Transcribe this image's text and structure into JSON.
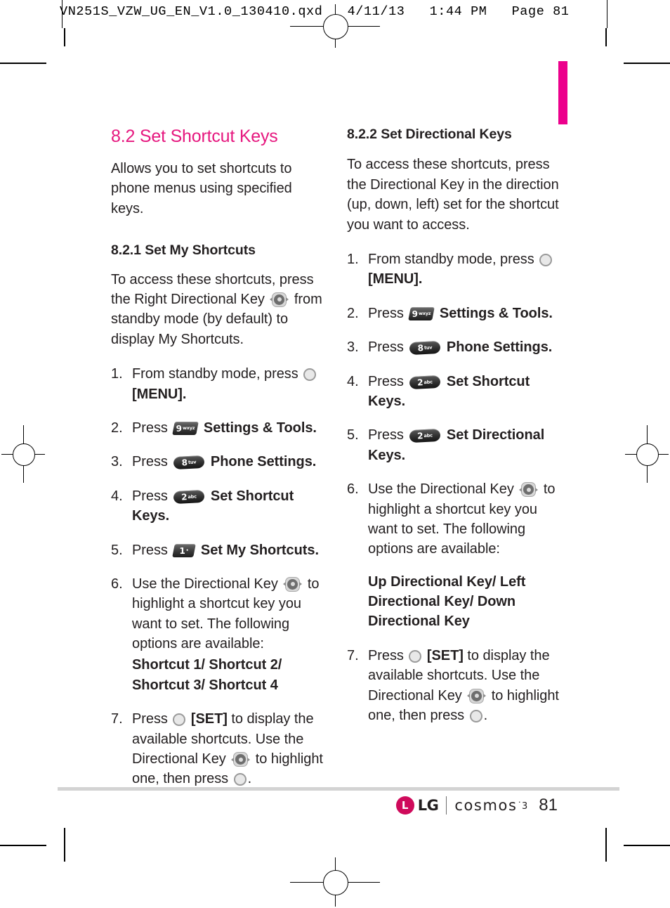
{
  "file_header": {
    "text": "VN251S_VZW_UG_EN_V1.0_130410.qxd   4/11/13   1:44 PM   Page 81"
  },
  "theme": {
    "accent_magenta": "#EC008C",
    "heading_pink": "#E6187F",
    "body_text": "#231F20",
    "logo_red": "#CF0A5B"
  },
  "left_column": {
    "section_title": "8.2 Set Shortcut Keys",
    "lead_paragraph": "Allows you to set shortcuts to phone menus using specified keys.",
    "subsection_title": "8.2.1 Set My Shortcuts",
    "intro_a": "To access these shortcuts, press the Right Directional Key",
    "intro_b": "from standby mode (by default) to display My Shortcuts.",
    "steps": [
      {
        "num": "1.",
        "text_a": "From standby mode, press",
        "icon": "ok-key-icon",
        "text_b": "[MENU].",
        "bold_b": true
      },
      {
        "num": "2.",
        "text_a": "Press",
        "icon": "keypad-9-wxyz-icon",
        "text_b": "Settings & Tools.",
        "bold_b": true
      },
      {
        "num": "3.",
        "text_a": "Press",
        "icon": "keypad-8-tuv-icon",
        "text_b": "Phone Settings.",
        "bold_b": true
      },
      {
        "num": "4.",
        "text_a": "Press",
        "icon": "keypad-2-abc-icon",
        "text_b": "Set Shortcut Keys.",
        "bold_b": true
      },
      {
        "num": "5.",
        "text_a": "Press",
        "icon": "keypad-1-icon",
        "text_b": "Set My Shortcuts.",
        "bold_b": true
      },
      {
        "num": "6.",
        "text_a": "Use the Directional Key",
        "icon": "directional-key-icon",
        "text_b": "to highlight a shortcut key you want to set. The following options are available:",
        "options": "Shortcut 1/ Shortcut 2/ Shortcut 3/ Shortcut 4"
      },
      {
        "num": "7.",
        "text_a": "Press",
        "icon": "ok-key-icon",
        "text_b": "[SET]",
        "text_c": "to display the available shortcuts. Use the Directional Key",
        "icon2": "directional-key-icon",
        "text_d": "to highlight one, then press",
        "icon3": "ok-key-icon",
        "text_e": "."
      }
    ]
  },
  "right_column": {
    "subsection_title": "8.2.2 Set Directional Keys",
    "intro": "To access these shortcuts, press the Directional Key in the direction (up, down, left) set for the shortcut you want to access.",
    "steps": [
      {
        "num": "1.",
        "text_a": "From standby mode, press",
        "icon": "ok-key-icon",
        "text_b": "[MENU].",
        "bold_b": true
      },
      {
        "num": "2.",
        "text_a": "Press",
        "icon": "keypad-9-wxyz-icon",
        "text_b": "Settings & Tools.",
        "bold_b": true
      },
      {
        "num": "3.",
        "text_a": "Press",
        "icon": "keypad-8-tuv-icon",
        "text_b": "Phone Settings.",
        "bold_b": true
      },
      {
        "num": "4.",
        "text_a": "Press",
        "icon": "keypad-2-abc-icon",
        "text_b": "Set Shortcut Keys.",
        "bold_b": true
      },
      {
        "num": "5.",
        "text_a": "Press",
        "icon": "keypad-2-abc-icon",
        "text_b": "Set Directional Keys.",
        "bold_b": true
      },
      {
        "num": "6.",
        "text_a": "Use the Directional Key",
        "icon": "directional-key-icon",
        "text_b": "to highlight a shortcut key you want to set. The following options are available:",
        "options": "Up Directional Key/ Left Directional Key/ Down Directional Key"
      },
      {
        "num": "7.",
        "text_a": "Press",
        "icon": "ok-key-icon",
        "text_b": "[SET]",
        "text_c": "to display the available shortcuts. Use the Directional Key",
        "icon2": "directional-key-icon",
        "text_d": "to highlight one, then press",
        "icon3": "ok-key-icon",
        "text_e": "."
      }
    ]
  },
  "keypad_icons": {
    "nine": {
      "digit": "9",
      "sub": "wxyz"
    },
    "eight": {
      "digit": "8",
      "sub": "tuv"
    },
    "two": {
      "digit": "2",
      "sub": "abc"
    },
    "one": {
      "digit": "1",
      "sub": "•"
    }
  },
  "footer": {
    "brand": "LG",
    "product": "cosmos",
    "product_sup": "˙3",
    "page_number": "81"
  }
}
